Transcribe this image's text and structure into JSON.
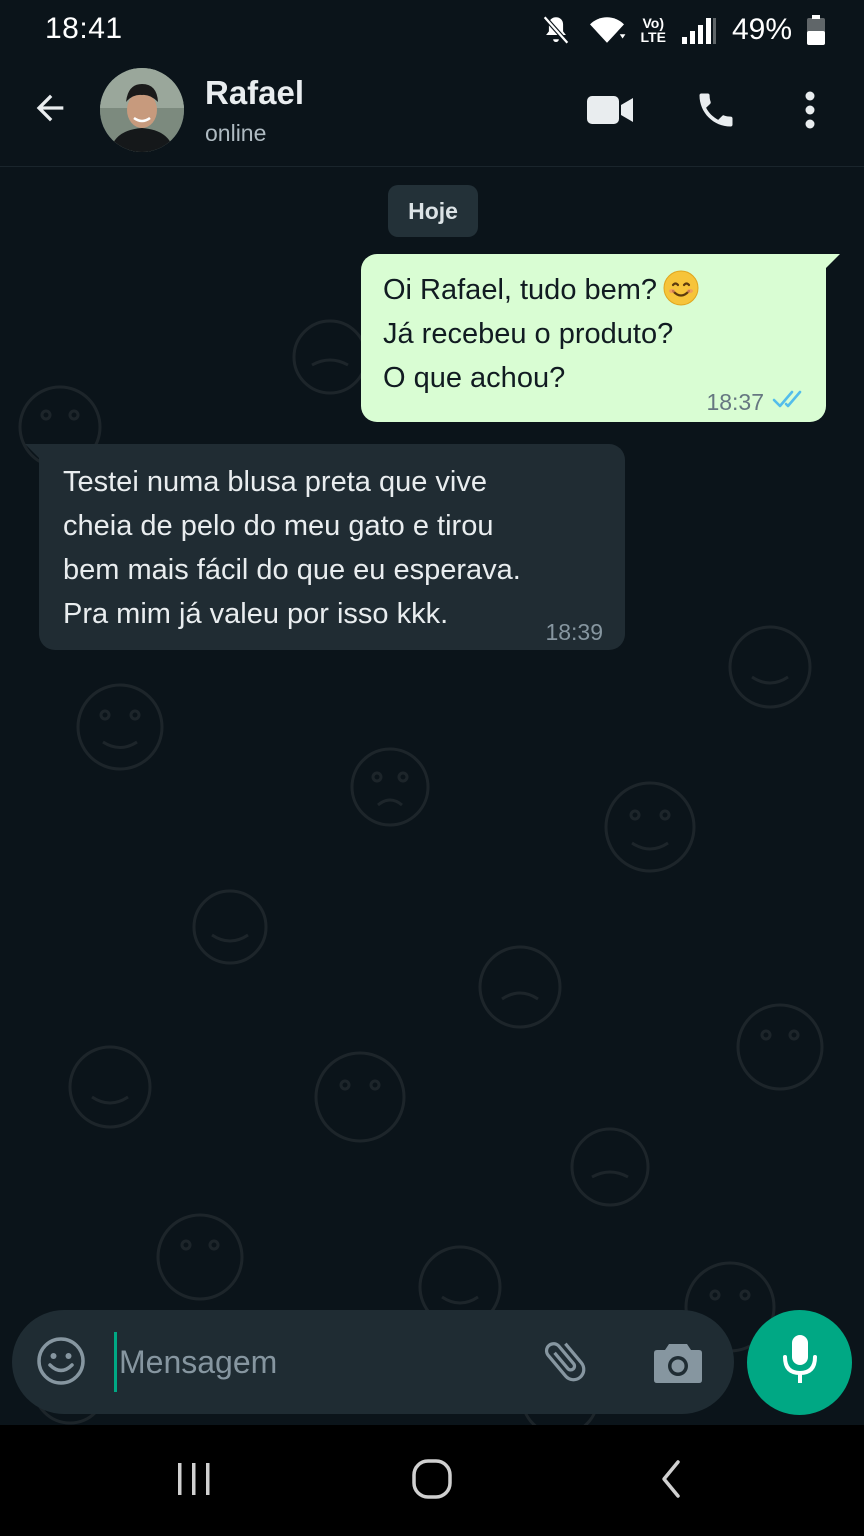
{
  "status_bar": {
    "time": "18:41",
    "network_label_top": "Vo)",
    "network_label_bottom": "LTE",
    "battery_percent": "49%",
    "icons": [
      "mute-notifications-icon",
      "wifi-icon",
      "volte-icon",
      "signal-icon",
      "battery-icon"
    ]
  },
  "header": {
    "contact_name": "Rafael",
    "contact_status": "online",
    "icons": [
      "back-arrow-icon",
      "video-call-icon",
      "voice-call-icon",
      "more-options-icon"
    ]
  },
  "chat": {
    "date_chip": "Hoje",
    "messages": [
      {
        "direction": "outgoing",
        "lines": [
          "Oi Rafael, tudo bem?",
          "Já recebeu o produto?",
          "O que achou?"
        ],
        "emoji": "smiling-face-emoji",
        "time": "18:37",
        "status": "read",
        "status_icon": "double-check-icon"
      },
      {
        "direction": "incoming",
        "lines": [
          "Testei numa blusa preta que vive",
          "cheia de pelo do meu gato e tirou",
          "bem mais fácil do que eu esperava.",
          "Pra mim já valeu por isso kkk."
        ],
        "time": "18:39"
      }
    ]
  },
  "composer": {
    "placeholder": "Mensagem",
    "value": "",
    "icons": [
      "emoji-icon",
      "attach-icon",
      "camera-icon",
      "mic-icon"
    ]
  },
  "nav": {
    "icons": [
      "recent-apps-icon",
      "home-icon",
      "back-icon"
    ]
  },
  "colors": {
    "background": "#0b141a",
    "outgoing_bubble": "#d9fdd3",
    "incoming_bubble": "#202c33",
    "accent": "#00a884",
    "read_ticks": "#53bdeb"
  }
}
